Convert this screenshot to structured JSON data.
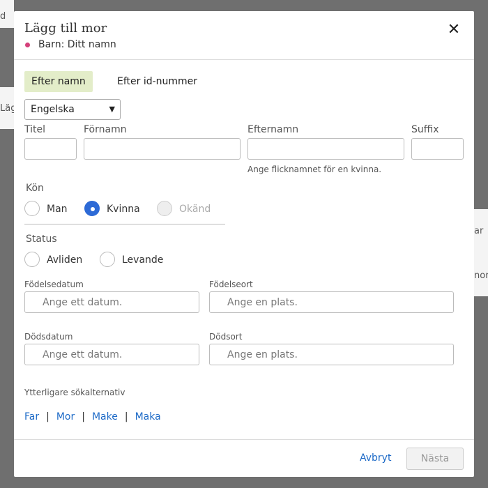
{
  "background": {
    "text_1": "d",
    "text_2": "Läg",
    "text_3": "ar",
    "text_4": "nor"
  },
  "modal": {
    "title": "Lägg till mor",
    "subtitle": "Barn: Ditt namn",
    "close_glyph": "✕"
  },
  "tabs": [
    {
      "label": "Efter namn",
      "active": true
    },
    {
      "label": "Efter id-nummer",
      "active": false
    }
  ],
  "language": {
    "selected": "Engelska"
  },
  "name_fields": {
    "title_label": "Titel",
    "first_label": "Förnamn",
    "last_label": "Efternamn",
    "suffix_label": "Suffix",
    "last_hint": "Ange flicknamnet för en kvinna."
  },
  "gender": {
    "label": "Kön",
    "options": [
      {
        "label": "Man",
        "checked": false,
        "disabled": false
      },
      {
        "label": "Kvinna",
        "checked": true,
        "disabled": false
      },
      {
        "label": "Okänd",
        "checked": false,
        "disabled": true
      }
    ]
  },
  "status": {
    "label": "Status",
    "options": [
      {
        "label": "Avliden",
        "checked": false
      },
      {
        "label": "Levande",
        "checked": false
      }
    ]
  },
  "birth": {
    "date_label": "Födelsedatum",
    "date_placeholder": "Ange ett datum.",
    "place_label": "Födelseort",
    "place_placeholder": "Ange en plats."
  },
  "death": {
    "date_label": "Dödsdatum",
    "date_placeholder": "Ange ett datum.",
    "place_label": "Dödsort",
    "place_placeholder": "Ange en plats."
  },
  "more_options": {
    "label": "Ytterligare sökalternativ",
    "links": [
      "Far",
      "Mor",
      "Make",
      "Maka"
    ],
    "separator": "|"
  },
  "footer": {
    "cancel_label": "Avbryt",
    "next_label": "Nästa"
  },
  "colors": {
    "accent": "#2d6ad6",
    "link": "#1d6ac7",
    "active_tab": "#e3edc9",
    "dot": "#d4407a"
  }
}
